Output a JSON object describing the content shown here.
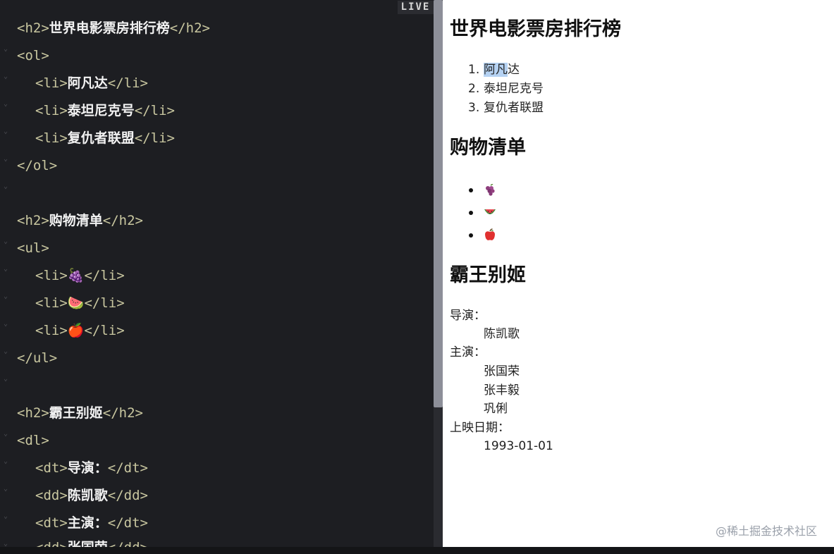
{
  "editor": {
    "live_badge": "LIVE",
    "lines": [
      {
        "tag_open": "<h2>",
        "text": "世界电影票房排行榜",
        "tag_close": "</h2>"
      },
      {
        "tag_open": "<ol>",
        "text": "",
        "tag_close": ""
      },
      {
        "tag_open": "<li>",
        "text": "阿凡达",
        "tag_close": "</li>"
      },
      {
        "tag_open": "<li>",
        "text": "泰坦尼克号",
        "tag_close": "</li>"
      },
      {
        "tag_open": "<li>",
        "text": "复仇者联盟",
        "tag_close": "</li>"
      },
      {
        "tag_open": "</ol>",
        "text": "",
        "tag_close": ""
      },
      {
        "tag_open": "<h2>",
        "text": "购物清单",
        "tag_close": "</h2>"
      },
      {
        "tag_open": "<ul>",
        "text": "",
        "tag_close": ""
      },
      {
        "tag_open": "<li>",
        "text": "🍇",
        "tag_close": "</li>"
      },
      {
        "tag_open": "<li>",
        "text": "🍉",
        "tag_close": "</li>"
      },
      {
        "tag_open": "<li>",
        "text": "🍎",
        "tag_close": "</li>"
      },
      {
        "tag_open": "</ul>",
        "text": "",
        "tag_close": ""
      },
      {
        "tag_open": "<h2>",
        "text": "霸王别姬",
        "tag_close": "</h2>"
      },
      {
        "tag_open": "<dl>",
        "text": "",
        "tag_close": ""
      },
      {
        "tag_open": "<dt>",
        "text": "导演：",
        "tag_close": "</dt>"
      },
      {
        "tag_open": "<dd>",
        "text": "陈凯歌",
        "tag_close": "</dd>"
      },
      {
        "tag_open": "<dt>",
        "text": "主演：",
        "tag_close": "</dt>"
      },
      {
        "tag_open": "<dd>",
        "text": "张国荣",
        "tag_close": "</dd>"
      }
    ]
  },
  "preview": {
    "section1": {
      "title": "世界电影票房排行榜",
      "items": [
        "阿凡达",
        "泰坦尼克号",
        "复仇者联盟"
      ],
      "numbers": [
        "1.",
        "2.",
        "3."
      ],
      "selected_part": "阿凡",
      "rest_part": "达"
    },
    "section2": {
      "title": "购物清单",
      "items": [
        "grape-icon",
        "watermelon-icon",
        "apple-icon"
      ]
    },
    "section3": {
      "title": "霸王别姬",
      "director_label": "导演：",
      "director": "陈凯歌",
      "cast_label": "主演：",
      "cast": [
        "张国荣",
        "张丰毅",
        "巩俐"
      ],
      "date_label": "上映日期：",
      "date": "1993-01-01"
    },
    "watermark": "@稀土掘金技术社区"
  },
  "colors": {
    "editor_bg": "#1d1e22",
    "tag": "#c9c7a0",
    "text": "#f2f2f2",
    "selection": "#b5d2f3"
  }
}
